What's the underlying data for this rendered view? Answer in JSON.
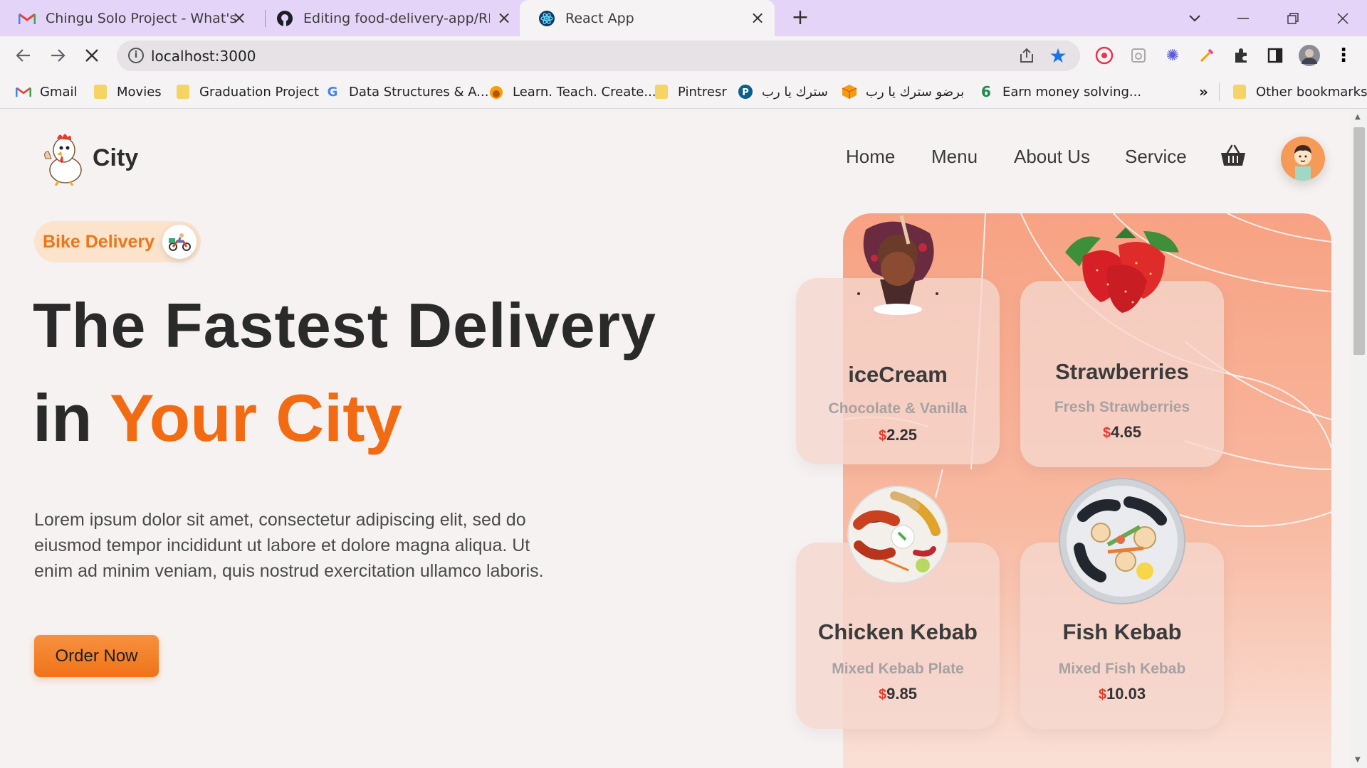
{
  "browser": {
    "tabs": [
      {
        "title": "Chingu Solo Project - What's you",
        "icon": "gmail-icon",
        "active": false
      },
      {
        "title": "Editing food-delivery-app/READM",
        "icon": "github-icon",
        "active": false
      },
      {
        "title": "React App",
        "icon": "react-icon",
        "active": true
      }
    ],
    "url": "localhost:3000",
    "bookmarks": [
      {
        "label": "Gmail",
        "icon": "gmail-icon"
      },
      {
        "label": "Movies",
        "icon": "folder-icon"
      },
      {
        "label": "Graduation Project",
        "icon": "folder-icon"
      },
      {
        "label": "Data Structures & A...",
        "icon": "google-icon"
      },
      {
        "label": "Learn. Teach. Create...",
        "icon": "fox-icon"
      },
      {
        "label": "Pintresr",
        "icon": "folder-icon"
      },
      {
        "label": "سترك يا رب",
        "icon": "p-icon"
      },
      {
        "label": "برضو سترك يا رب",
        "icon": "box-icon"
      },
      {
        "label": "Earn money solving...",
        "icon": "six-icon"
      },
      {
        "label": "Other bookmarks",
        "icon": "folder-icon"
      }
    ],
    "overflow_label": "»"
  },
  "site": {
    "brand": "City",
    "nav": [
      "Home",
      "Menu",
      "About Us",
      "Service"
    ],
    "badge": "Bike Delivery",
    "headline_line1": "The Fastest Delivery",
    "headline_in": "in",
    "headline_accent": "Your City",
    "description": "Lorem ipsum dolor sit amet, consectetur adipiscing elit, sed do eiusmod tempor incididunt ut labore et dolore magna aliqua. Ut enim ad minim veniam, quis nostrud exercitation ullamco laboris.",
    "cta": "Order Now",
    "currency": "$",
    "cards": [
      {
        "title": "iceCream",
        "subtitle": "Chocolate & Vanilla",
        "price": "2.25"
      },
      {
        "title": "Strawberries",
        "subtitle": "Fresh Strawberries",
        "price": "4.65"
      },
      {
        "title": "Chicken Kebab",
        "subtitle": "Mixed Kebab Plate",
        "price": "9.85"
      },
      {
        "title": "Fish Kebab",
        "subtitle": "Mixed Fish Kebab",
        "price": "10.03"
      }
    ]
  },
  "colors": {
    "accent": "#f26b12",
    "tabbar": "#e4d4f7",
    "panel": "#f7a283"
  }
}
